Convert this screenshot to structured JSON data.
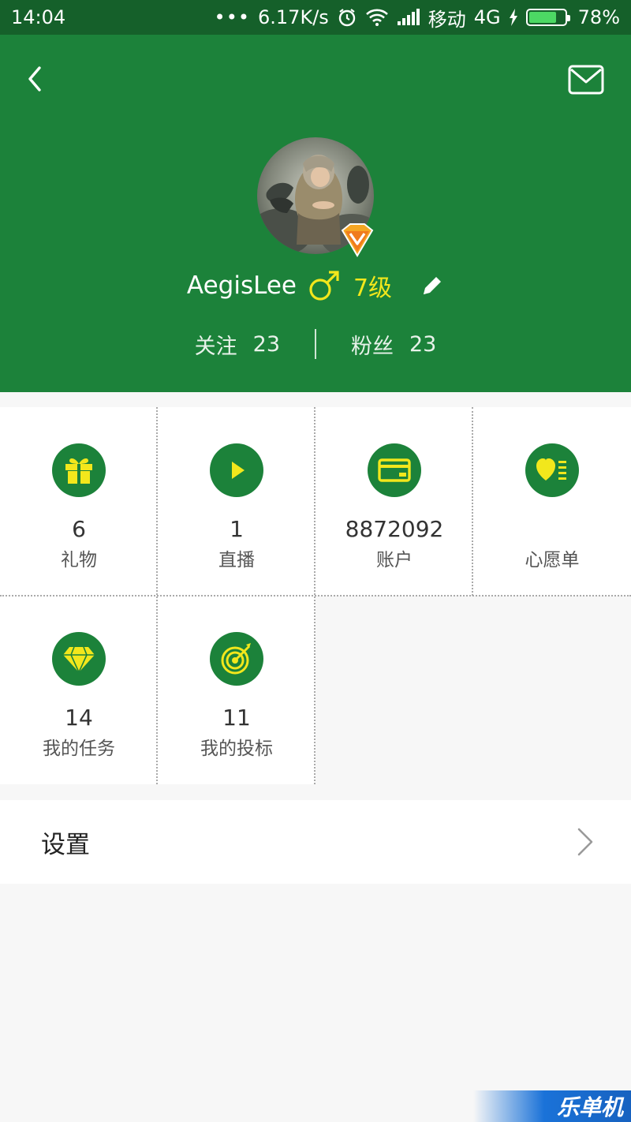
{
  "status_bar": {
    "time": "14:04",
    "dots": "•••",
    "speed": "6.17K/s",
    "carrier": "移动",
    "network": "4G",
    "battery": "78%",
    "battery_level": 0.78,
    "icons": [
      "alarm-icon",
      "wifi-icon",
      "signal-icon",
      "charging-icon",
      "battery-icon"
    ]
  },
  "header": {
    "background": "#1c823a",
    "username": "AegisLee",
    "gender_icon": "male-icon",
    "level": "7级",
    "level_color": "#f2e71c",
    "follow_label": "关注",
    "follow_count": "23",
    "fans_label": "粉丝",
    "fans_count": "23"
  },
  "grid_items": [
    {
      "icon": "gift-icon",
      "value": "6",
      "label": "礼物"
    },
    {
      "icon": "play-icon",
      "value": "1",
      "label": "直播"
    },
    {
      "icon": "card-icon",
      "value": "8872092",
      "label": "账户"
    },
    {
      "icon": "heart-list-icon",
      "value": "",
      "label": "心愿单"
    },
    {
      "icon": "diamond-icon",
      "value": "14",
      "label": "我的任务"
    },
    {
      "icon": "target-icon",
      "value": "11",
      "label": "我的投标"
    }
  ],
  "settings": {
    "label": "设置"
  },
  "watermark": {
    "text": "乐单机"
  }
}
